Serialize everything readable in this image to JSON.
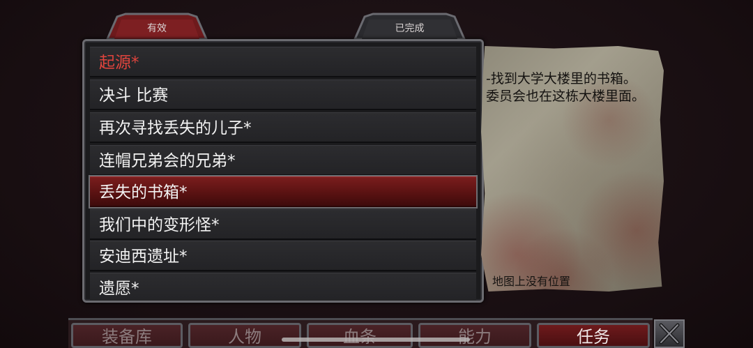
{
  "tabs": {
    "active": "有效",
    "completed": "已完成"
  },
  "quests": [
    {
      "label": "起源*",
      "style": "red"
    },
    {
      "label": "决斗 比赛",
      "style": "normal"
    },
    {
      "label": "再次寻找丢失的儿子*",
      "style": "normal"
    },
    {
      "label": "连帽兄弟会的兄弟*",
      "style": "normal"
    },
    {
      "label": "丢失的书箱*",
      "style": "selected"
    },
    {
      "label": "我们中的变形怪*",
      "style": "normal"
    },
    {
      "label": "安迪西遗址*",
      "style": "normal"
    },
    {
      "label": "遗愿*",
      "style": "normal"
    }
  ],
  "description": {
    "text": "-找到大学大楼里的书箱。 委员会也在这栋大楼里面。",
    "map_status": "地图上没有位置"
  },
  "nav": {
    "inventory": "装备库",
    "character": "人物",
    "blood": "血条",
    "abilities": "能力",
    "quests": "任务"
  },
  "icons": {
    "close": "close-x-icon"
  },
  "colors": {
    "accent_red": "#e0443d",
    "selected_bg": "#6a1515"
  }
}
